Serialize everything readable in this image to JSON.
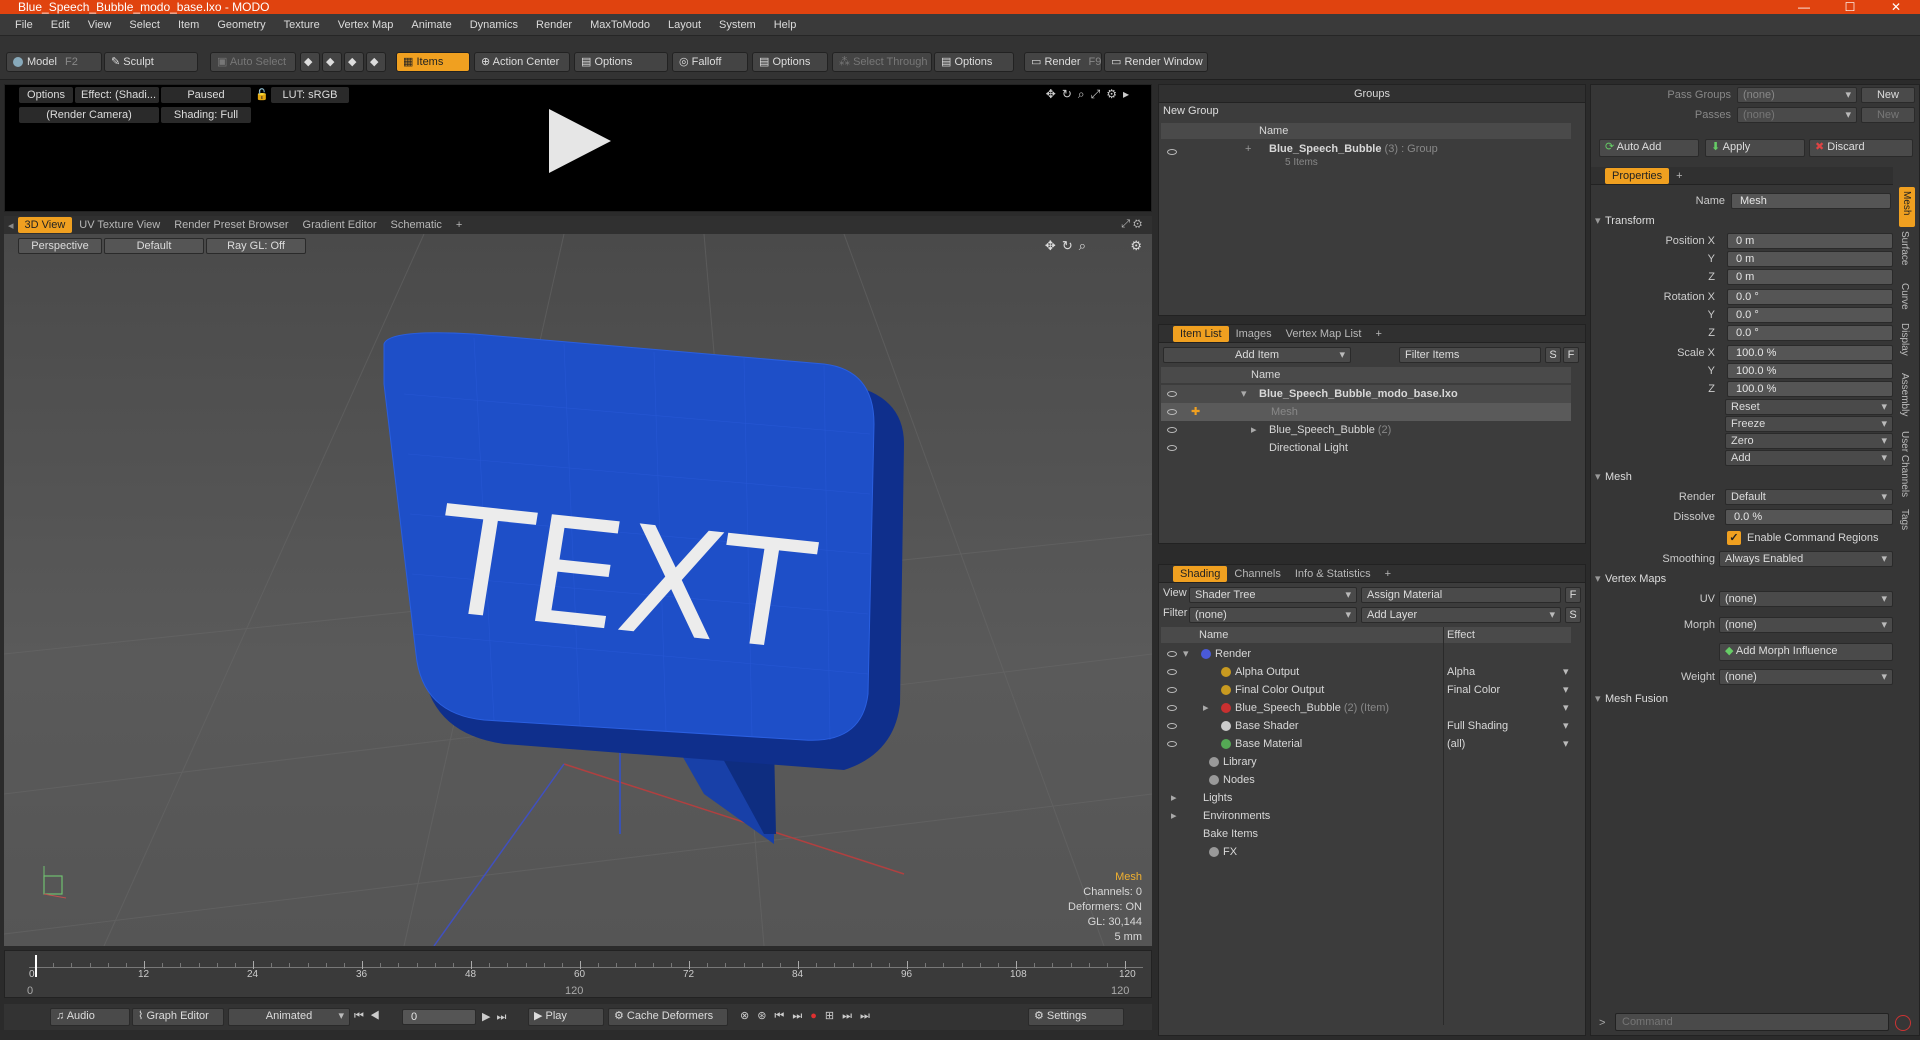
{
  "window": {
    "title": "Blue_Speech_Bubble_modo_base.lxo - MODO",
    "minimize": "—",
    "maximize": "☐",
    "close": "✕"
  },
  "menu": [
    "File",
    "Edit",
    "View",
    "Select",
    "Item",
    "Geometry",
    "Texture",
    "Vertex Map",
    "Animate",
    "Dynamics",
    "Render",
    "MaxToModo",
    "Layout",
    "System",
    "Help"
  ],
  "toolbar": {
    "model": "Model",
    "model_key": "F2",
    "sculpt": "Sculpt",
    "auto_select": "Auto Select",
    "items": "Items",
    "action_center": "Action Center",
    "options1": "Options",
    "falloff": "Falloff",
    "options2": "Options",
    "select_through": "Select Through",
    "options3": "Options",
    "render": "Render",
    "render_key": "F9",
    "render_window": "Render Window"
  },
  "preview": {
    "options": "Options",
    "effect": "Effect: (Shadi...",
    "paused": "Paused",
    "lut": "LUT: sRGB",
    "camera": "(Render Camera)",
    "shading": "Shading: Full"
  },
  "viewport": {
    "tabs": [
      "3D View",
      "UV Texture View",
      "Render Preset Browser",
      "Gradient Editor",
      "Schematic"
    ],
    "add_tab": "+",
    "perspective": "Perspective",
    "default": "Default",
    "raygl": "Ray GL: Off",
    "bubble_text": "TEXT",
    "info": {
      "mesh": "Mesh",
      "channels": "Channels: 0",
      "deformers": "Deformers: ON",
      "gl": "GL: 30,144",
      "mm": "5 mm"
    }
  },
  "timeline": {
    "ticks": [
      "0",
      "12",
      "24",
      "36",
      "48",
      "60",
      "72",
      "84",
      "96",
      "108",
      "120"
    ],
    "lower_left": "0",
    "lower_mid": "120",
    "lower_right": "120"
  },
  "transport": {
    "audio": "Audio",
    "graph_editor": "Graph Editor",
    "animated": "Animated",
    "frame": "0",
    "play": "Play",
    "cache": "Cache Deformers",
    "settings": "Settings"
  },
  "groups": {
    "title": "Groups",
    "new_group": "New Group",
    "col_name": "Name",
    "item_name": "Blue_Speech_Bubble",
    "item_count": "(3)",
    "item_type": ": Group",
    "item_sub": "5 Items"
  },
  "itemlist": {
    "tabs": [
      "Item List",
      "Images",
      "Vertex Map List"
    ],
    "add_tab": "+",
    "add_item": "Add Item",
    "filter": "Filter Items",
    "s": "S",
    "f": "F",
    "col_name": "Name",
    "rows": [
      {
        "name": "Blue_Speech_Bubble_modo_base.lxo",
        "extra": ""
      },
      {
        "name": "Mesh",
        "extra": ""
      },
      {
        "name": "Blue_Speech_Bubble",
        "extra": "(2)"
      },
      {
        "name": "Directional Light",
        "extra": ""
      }
    ]
  },
  "shading": {
    "tabs": [
      "Shading",
      "Channels",
      "Info & Statistics"
    ],
    "add_tab": "+",
    "view_label": "View",
    "view_value": "Shader Tree",
    "assign": "Assign Material",
    "f": "F",
    "filter_label": "Filter",
    "filter_value": "(none)",
    "add_layer": "Add Layer",
    "s": "S",
    "col_name": "Name",
    "col_effect": "Effect",
    "rows": [
      {
        "name": "Render",
        "extra": "",
        "effect": "",
        "color": "#4a5ad8"
      },
      {
        "name": "Alpha Output",
        "extra": "",
        "effect": "Alpha",
        "color": "#c89a20"
      },
      {
        "name": "Final Color Output",
        "extra": "",
        "effect": "Final Color",
        "color": "#c89a20"
      },
      {
        "name": "Blue_Speech_Bubble",
        "extra": "(2) (Item)",
        "effect": "",
        "color": "#c83030"
      },
      {
        "name": "Base Shader",
        "extra": "",
        "effect": "Full Shading",
        "color": "#cccccc"
      },
      {
        "name": "Base Material",
        "extra": "",
        "effect": "(all)",
        "color": "#55aa55"
      },
      {
        "name": "Library",
        "extra": "",
        "effect": "",
        "color": "#999999"
      },
      {
        "name": "Nodes",
        "extra": "",
        "effect": "",
        "color": "#999999"
      },
      {
        "name": "Lights",
        "extra": "",
        "effect": "",
        "color": ""
      },
      {
        "name": "Environments",
        "extra": "",
        "effect": "",
        "color": ""
      },
      {
        "name": "Bake Items",
        "extra": "",
        "effect": "",
        "color": ""
      },
      {
        "name": "FX",
        "extra": "",
        "effect": "",
        "color": "#999999"
      }
    ]
  },
  "right": {
    "pass_groups": "Pass Groups",
    "passes": "Passes",
    "none": "(none)",
    "new": "New",
    "auto_add": "Auto Add",
    "apply": "Apply",
    "discard": "Discard",
    "properties_tab": "Properties",
    "add_tab": "+",
    "name_label": "Name",
    "name_value": "Mesh",
    "transform": "Transform",
    "position_x_label": "Position X",
    "y": "Y",
    "z": "Z",
    "pos": [
      "0 m",
      "0 m",
      "0 m"
    ],
    "rotation_x_label": "Rotation X",
    "rot": [
      "0.0 °",
      "0.0 °",
      "0.0 °"
    ],
    "scale_x_label": "Scale X",
    "scale": [
      "100.0 %",
      "100.0 %",
      "100.0 %"
    ],
    "reset": "Reset",
    "freeze": "Freeze",
    "zero": "Zero",
    "add": "Add",
    "mesh": "Mesh",
    "render_label": "Render",
    "render_value": "Default",
    "dissolve_label": "Dissolve",
    "dissolve_value": "0.0 %",
    "enable_cmd": "Enable Command Regions",
    "smoothing_label": "Smoothing",
    "smoothing_value": "Always Enabled",
    "vertex_maps": "Vertex Maps",
    "uv_label": "UV",
    "uv_value": "(none)",
    "morph_label": "Morph",
    "morph_value": "(none)",
    "add_morph": "Add Morph Influence",
    "weight_label": "Weight",
    "weight_value": "(none)",
    "mesh_fusion": "Mesh Fusion",
    "side_tabs": [
      "Mesh",
      "Surface",
      "Curve",
      "Display",
      "Assembly",
      "User Channels",
      "Tags"
    ],
    "command_placeholder": "Command"
  }
}
